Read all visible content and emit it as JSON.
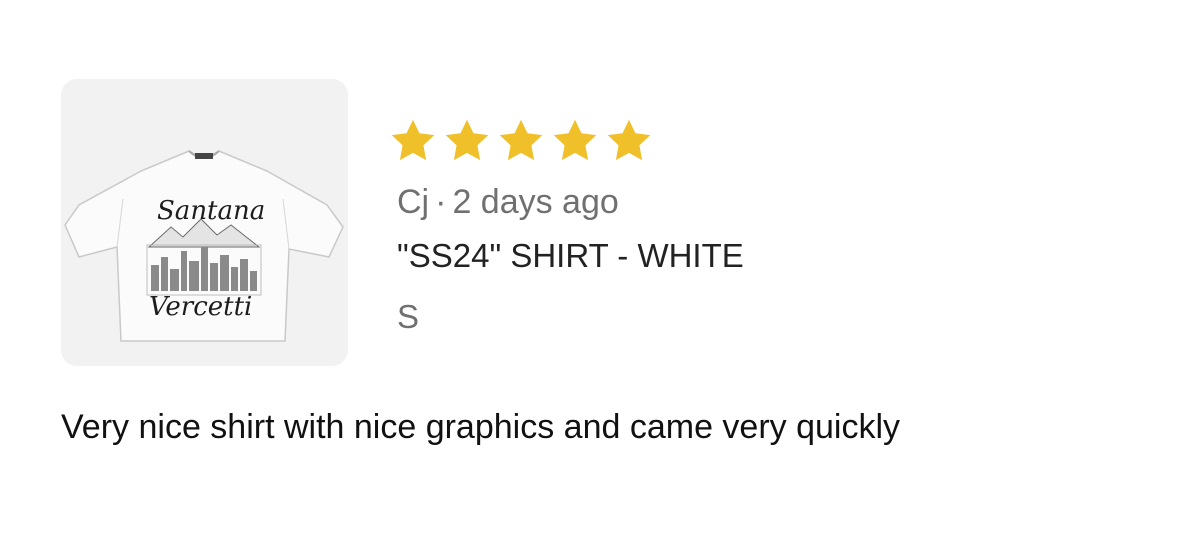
{
  "review": {
    "rating": 5,
    "rating_max": 5,
    "star_color": "#F0C02A",
    "author": "Cj",
    "separator": "·",
    "time_ago": "2 days ago",
    "product_name": "\"SS24\" SHIRT - WHITE",
    "variant": "S",
    "body": "Very nice shirt with nice graphics and came very quickly",
    "product_image": {
      "print_top": "Santana",
      "print_bottom": "Vercetti"
    }
  }
}
